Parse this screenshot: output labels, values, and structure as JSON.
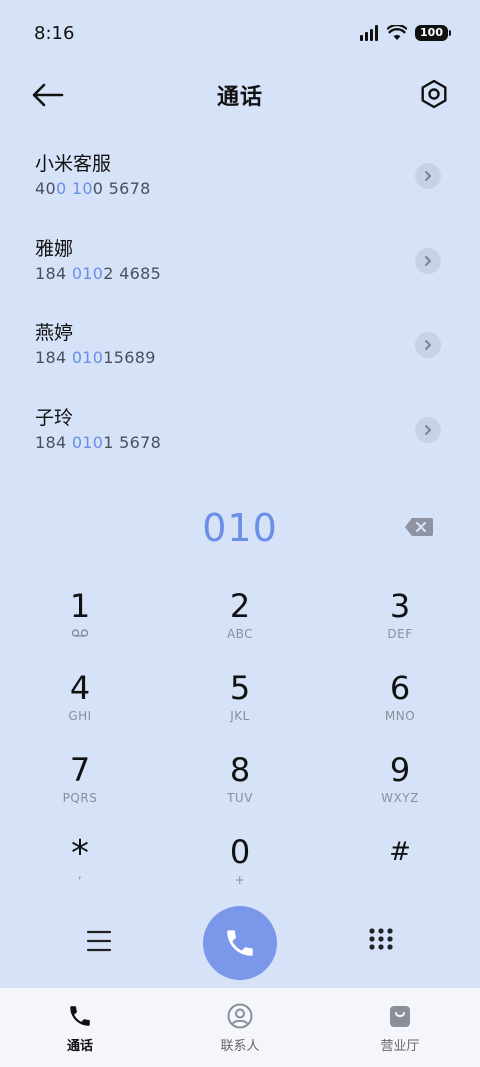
{
  "status_bar": {
    "time": "8:16",
    "battery": "100"
  },
  "header": {
    "title": "通话"
  },
  "contacts": [
    {
      "name": "小米客服",
      "number_pre": "40",
      "number_hl": "0 10",
      "number_post": "0 5678"
    },
    {
      "name": "雅娜",
      "number_pre": "184 ",
      "number_hl": "010",
      "number_post": "2 4685"
    },
    {
      "name": "燕婷",
      "number_pre": "184 ",
      "number_hl": "010",
      "number_post": "15689"
    },
    {
      "name": "子玲",
      "number_pre": "184 ",
      "number_hl": "010",
      "number_post": "1 5678"
    }
  ],
  "dial_input": {
    "value": "010"
  },
  "keypad": [
    {
      "digit": "1",
      "letters": ""
    },
    {
      "digit": "2",
      "letters": "ABC"
    },
    {
      "digit": "3",
      "letters": "DEF"
    },
    {
      "digit": "4",
      "letters": "GHI"
    },
    {
      "digit": "5",
      "letters": "JKL"
    },
    {
      "digit": "6",
      "letters": "MNO"
    },
    {
      "digit": "7",
      "letters": "PQRS"
    },
    {
      "digit": "8",
      "letters": "TUV"
    },
    {
      "digit": "9",
      "letters": "WXYZ"
    },
    {
      "digit": "*",
      "letters": ","
    },
    {
      "digit": "0",
      "letters": "+"
    },
    {
      "digit": "#",
      "letters": ""
    }
  ],
  "tabs": [
    {
      "label": "通话",
      "icon": "phone-icon"
    },
    {
      "label": "联系人",
      "icon": "contact-icon"
    },
    {
      "label": "营业厅",
      "icon": "shopping-bag-icon"
    }
  ],
  "colors": {
    "background": "#d6e2f8",
    "accent": "#6b8ee8",
    "call_button": "#7b97ea"
  }
}
